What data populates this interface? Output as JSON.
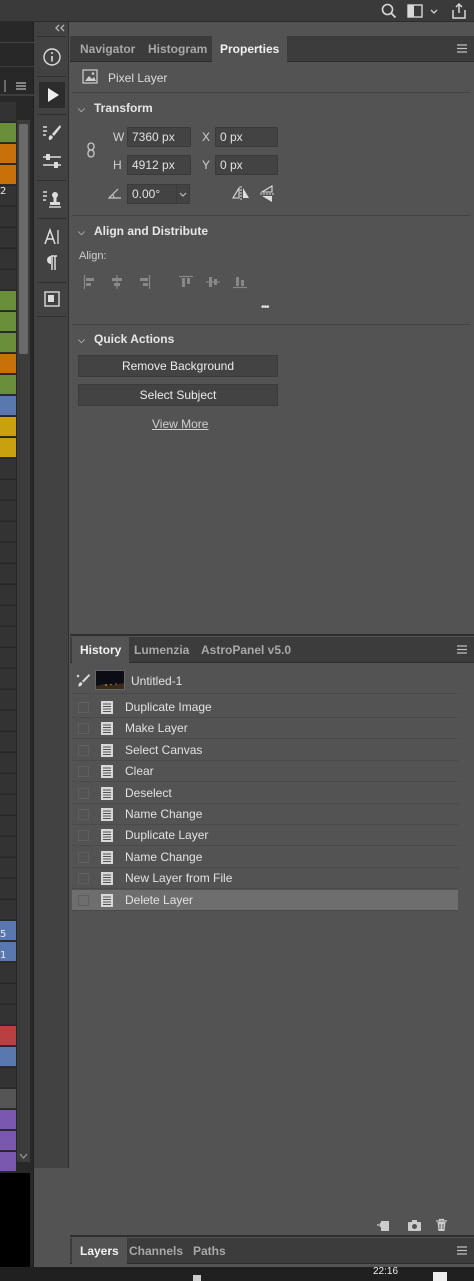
{
  "properties_panel": {
    "tabs": [
      "Navigator",
      "Histogram",
      "Properties"
    ],
    "active_tab": "Properties",
    "layer_kind": "Pixel Layer",
    "transform": {
      "title": "Transform",
      "w_label": "W",
      "w_value": "7360 px",
      "h_label": "H",
      "h_value": "4912 px",
      "x_label": "X",
      "x_value": "0 px",
      "y_label": "Y",
      "y_value": "0 px",
      "angle_value": "0.00°"
    },
    "align": {
      "title": "Align and Distribute",
      "align_label": "Align:",
      "more": "•••"
    },
    "quick_actions": {
      "title": "Quick Actions",
      "remove_background": "Remove Background",
      "select_subject": "Select Subject",
      "view_more": "View More"
    }
  },
  "history_panel": {
    "tabs": [
      "History",
      "Lumenzia",
      "AstroPanel v5.0"
    ],
    "active_tab": "History",
    "snapshot_name": "Untitled-1",
    "items": [
      "Duplicate Image",
      "Make Layer",
      "Select Canvas",
      "Clear",
      "Deselect",
      "Name Change",
      "Duplicate Layer",
      "Name Change",
      "New Layer from File",
      "Delete Layer"
    ],
    "selected_item": "Delete Layer"
  },
  "layers_panel": {
    "tabs": [
      "Layers",
      "Channels",
      "Paths"
    ],
    "active_tab": "Layers"
  },
  "doc_strip": {
    "numbers": [
      "2",
      "5",
      "1"
    ]
  },
  "taskbar": {
    "time": "22:16"
  },
  "colors": {
    "panel_bg": "#535353",
    "tab_bg": "#3c3c3c",
    "selected_row": "#6e6e6e",
    "label_green": "#6a8f3a",
    "label_orange": "#c8700a",
    "label_yellow": "#c9a010",
    "label_blue": "#5a78b0",
    "label_red": "#b84040",
    "label_violet": "#7a58b0"
  }
}
